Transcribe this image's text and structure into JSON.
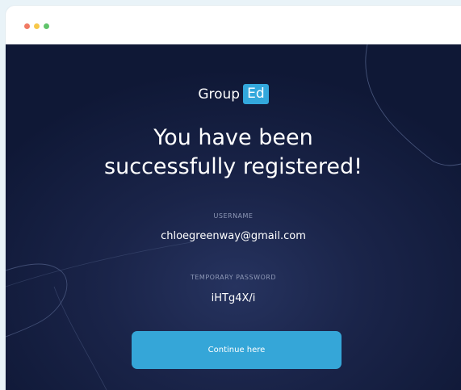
{
  "window": {
    "controls": [
      "close",
      "minimize",
      "maximize"
    ]
  },
  "logo": {
    "text": "Group",
    "badge": "Ed"
  },
  "headline": {
    "line1": "You have been",
    "line2": "successfully registered!"
  },
  "credentials": {
    "username_label": "USERNAME",
    "username_value": "chloegreenway@gmail.com",
    "password_label": "TEMPORARY PASSWORD",
    "password_value": "iHTg4X/i"
  },
  "continue_button": {
    "label": "Continue here"
  },
  "colors": {
    "background_dark": "#0f1836",
    "accent": "#35a6d8",
    "label_muted": "#8e98b6"
  }
}
